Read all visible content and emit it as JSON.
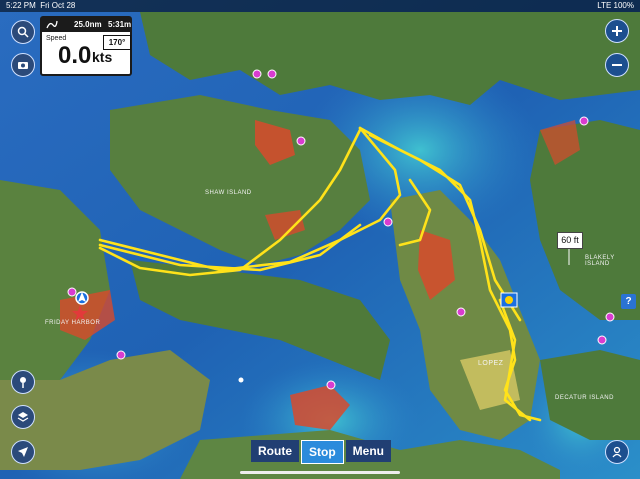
{
  "status_bar": {
    "time": "5:22 PM",
    "date": "Fri Oct 28",
    "right": "LTE 100%"
  },
  "data_panel": {
    "distance": "25.0nm",
    "time_to": "5:31m",
    "heading": "170°",
    "speed_label": "Speed",
    "speed_value": "0.0",
    "speed_unit": "kts"
  },
  "depth_label": "60 ft",
  "map_labels": {
    "shaw_island": "SHAW ISLAND",
    "lopez": "LOPEZ",
    "friday_harbor": "FRIDAY HARBOR",
    "decatur": "DECATUR ISLAND",
    "blakely": "BLAKELY ISLAND"
  },
  "bottom_toolbar": {
    "route": "Route",
    "stop": "Stop",
    "menu": "Menu"
  },
  "icons": {
    "search": "search-icon",
    "camera": "camera-icon",
    "zoom_in": "plus-icon",
    "zoom_out": "minus-icon",
    "pin": "pin-icon",
    "layers": "layers-icon",
    "locate": "location-arrow-icon",
    "person": "person-icon",
    "help": "?"
  },
  "colors": {
    "route_line": "#ffe21a",
    "water_deep": "#1e5aa8",
    "land": "#4d7a3a",
    "shoal": "#d84a2c",
    "button_active": "#2b8bdc"
  }
}
